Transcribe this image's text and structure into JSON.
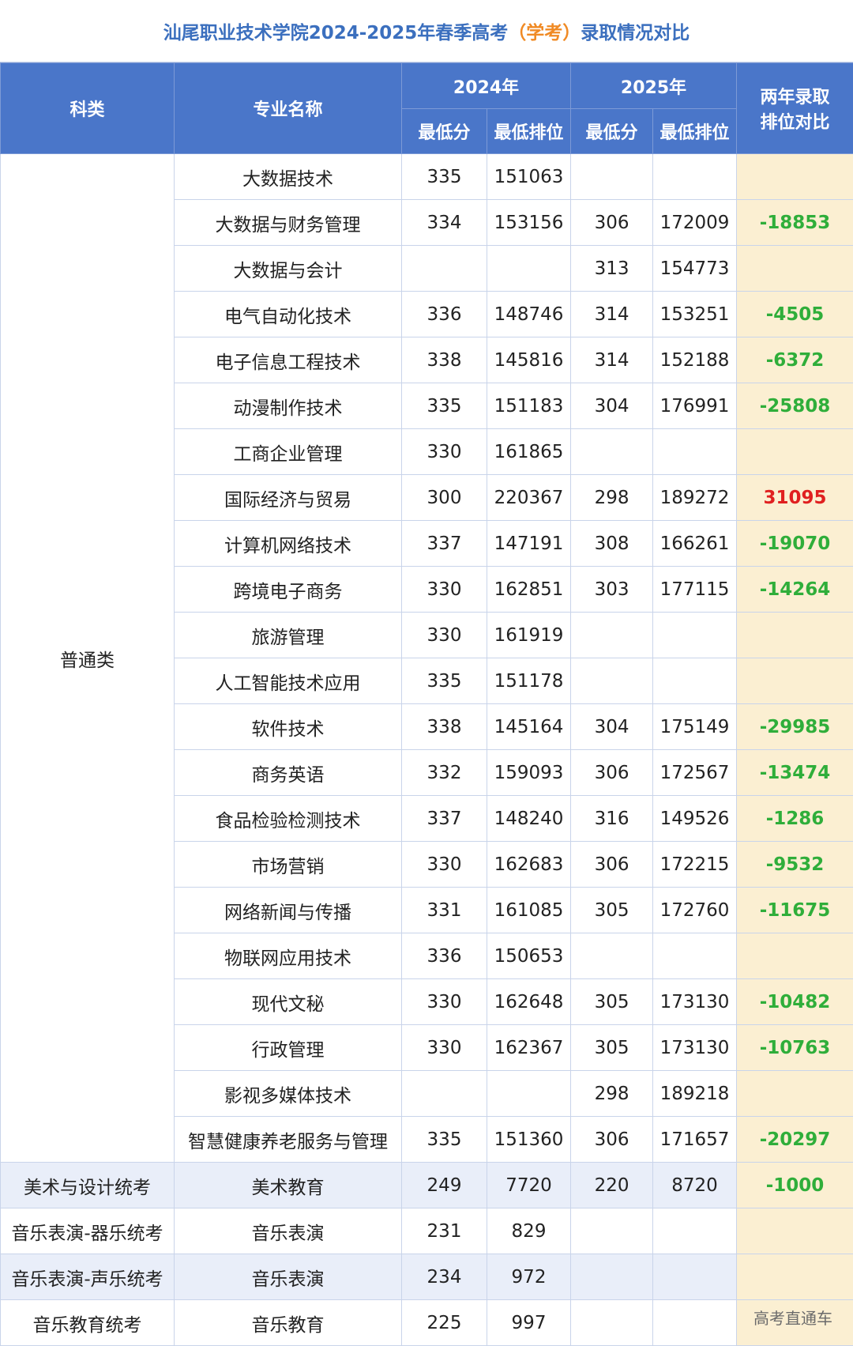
{
  "title": {
    "before": "汕尾职业技术学院2024-2025年春季高考",
    "highlight": "（学考）",
    "after": "录取情况对比"
  },
  "header": {
    "category": "科类",
    "major": "专业名称",
    "year_2024": "2024年",
    "year_2025": "2025年",
    "compare_line1": "两年录取",
    "compare_line2": "排位对比",
    "min_score": "最低分",
    "min_rank": "最低排位"
  },
  "ordinary_category": "普通类",
  "ordinary_rows": [
    {
      "major": "大数据技术",
      "s24": "335",
      "r24": "151063",
      "s25": "",
      "r25": "",
      "cmp": ""
    },
    {
      "major": "大数据与财务管理",
      "s24": "334",
      "r24": "153156",
      "s25": "306",
      "r25": "172009",
      "cmp": "-18853"
    },
    {
      "major": "大数据与会计",
      "s24": "",
      "r24": "",
      "s25": "313",
      "r25": "154773",
      "cmp": ""
    },
    {
      "major": "电气自动化技术",
      "s24": "336",
      "r24": "148746",
      "s25": "314",
      "r25": "153251",
      "cmp": "-4505"
    },
    {
      "major": "电子信息工程技术",
      "s24": "338",
      "r24": "145816",
      "s25": "314",
      "r25": "152188",
      "cmp": "-6372"
    },
    {
      "major": "动漫制作技术",
      "s24": "335",
      "r24": "151183",
      "s25": "304",
      "r25": "176991",
      "cmp": "-25808"
    },
    {
      "major": "工商企业管理",
      "s24": "330",
      "r24": "161865",
      "s25": "",
      "r25": "",
      "cmp": ""
    },
    {
      "major": "国际经济与贸易",
      "s24": "300",
      "r24": "220367",
      "s25": "298",
      "r25": "189272",
      "cmp": "31095"
    },
    {
      "major": "计算机网络技术",
      "s24": "337",
      "r24": "147191",
      "s25": "308",
      "r25": "166261",
      "cmp": "-19070"
    },
    {
      "major": "跨境电子商务",
      "s24": "330",
      "r24": "162851",
      "s25": "303",
      "r25": "177115",
      "cmp": "-14264"
    },
    {
      "major": "旅游管理",
      "s24": "330",
      "r24": "161919",
      "s25": "",
      "r25": "",
      "cmp": ""
    },
    {
      "major": "人工智能技术应用",
      "s24": "335",
      "r24": "151178",
      "s25": "",
      "r25": "",
      "cmp": ""
    },
    {
      "major": "软件技术",
      "s24": "338",
      "r24": "145164",
      "s25": "304",
      "r25": "175149",
      "cmp": "-29985"
    },
    {
      "major": "商务英语",
      "s24": "332",
      "r24": "159093",
      "s25": "306",
      "r25": "172567",
      "cmp": "-13474"
    },
    {
      "major": "食品检验检测技术",
      "s24": "337",
      "r24": "148240",
      "s25": "316",
      "r25": "149526",
      "cmp": "-1286"
    },
    {
      "major": "市场营销",
      "s24": "330",
      "r24": "162683",
      "s25": "306",
      "r25": "172215",
      "cmp": "-9532"
    },
    {
      "major": "网络新闻与传播",
      "s24": "331",
      "r24": "161085",
      "s25": "305",
      "r25": "172760",
      "cmp": "-11675"
    },
    {
      "major": "物联网应用技术",
      "s24": "336",
      "r24": "150653",
      "s25": "",
      "r25": "",
      "cmp": ""
    },
    {
      "major": "现代文秘",
      "s24": "330",
      "r24": "162648",
      "s25": "305",
      "r25": "173130",
      "cmp": "-10482"
    },
    {
      "major": "行政管理",
      "s24": "330",
      "r24": "162367",
      "s25": "305",
      "r25": "173130",
      "cmp": "-10763"
    },
    {
      "major": "影视多媒体技术",
      "s24": "",
      "r24": "",
      "s25": "298",
      "r25": "189218",
      "cmp": ""
    },
    {
      "major": "智慧健康养老服务与管理",
      "s24": "335",
      "r24": "151360",
      "s25": "306",
      "r25": "171657",
      "cmp": "-20297"
    }
  ],
  "other_rows": [
    {
      "category": "美术与设计统考",
      "major": "美术教育",
      "s24": "249",
      "r24": "7720",
      "s25": "220",
      "r25": "8720",
      "cmp": "-1000",
      "alt": true
    },
    {
      "category": "音乐表演-器乐统考",
      "major": "音乐表演",
      "s24": "231",
      "r24": "829",
      "s25": "",
      "r25": "",
      "cmp": "",
      "alt": false
    },
    {
      "category": "音乐表演-声乐统考",
      "major": "音乐表演",
      "s24": "234",
      "r24": "972",
      "s25": "",
      "r25": "",
      "cmp": "",
      "alt": true
    },
    {
      "category": "音乐教育统考",
      "major": "音乐教育",
      "s24": "225",
      "r24": "997",
      "s25": "",
      "r25": "",
      "cmp": "",
      "alt": false
    }
  ],
  "watermark_brand": "高考直通车",
  "colors": {
    "header_blue": "#4a76c9",
    "title_blue": "#3b6fbe",
    "title_orange": "#f08a24",
    "compare_bg": "#fbefd2",
    "negative_green": "#2fae3a",
    "positive_red": "#e02020"
  }
}
